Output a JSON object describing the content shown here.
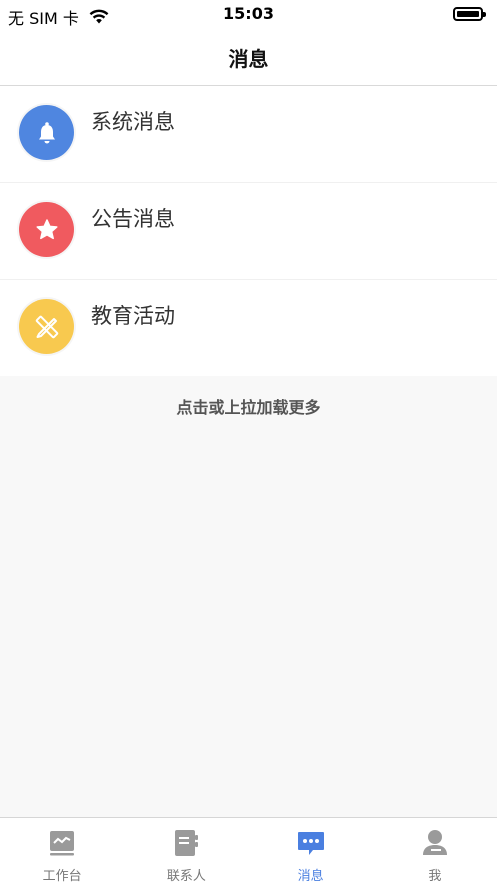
{
  "status_bar": {
    "carrier": "无 SIM 卡",
    "time": "15:03",
    "icons": [
      "wifi-icon",
      "battery-icon"
    ]
  },
  "nav": {
    "title": "消息"
  },
  "messages": [
    {
      "label": "系统消息",
      "icon": "bell-icon",
      "color": "#4f86e0"
    },
    {
      "label": "公告消息",
      "icon": "star-icon",
      "color": "#f05a5f"
    },
    {
      "label": "教育活动",
      "icon": "pencil-ruler-icon",
      "color": "#f8c94f"
    }
  ],
  "load_more": "点击或上拉加载更多",
  "tabs": [
    {
      "label": "工作台",
      "icon": "workbench-icon",
      "active": false
    },
    {
      "label": "联系人",
      "icon": "contacts-icon",
      "active": false
    },
    {
      "label": "消息",
      "icon": "message-icon",
      "active": true
    },
    {
      "label": "我",
      "icon": "profile-icon",
      "active": false
    }
  ],
  "colors": {
    "accent": "#4a7fe0",
    "tab_inactive": "#9a9a9a",
    "background": "#f8f8f8"
  }
}
